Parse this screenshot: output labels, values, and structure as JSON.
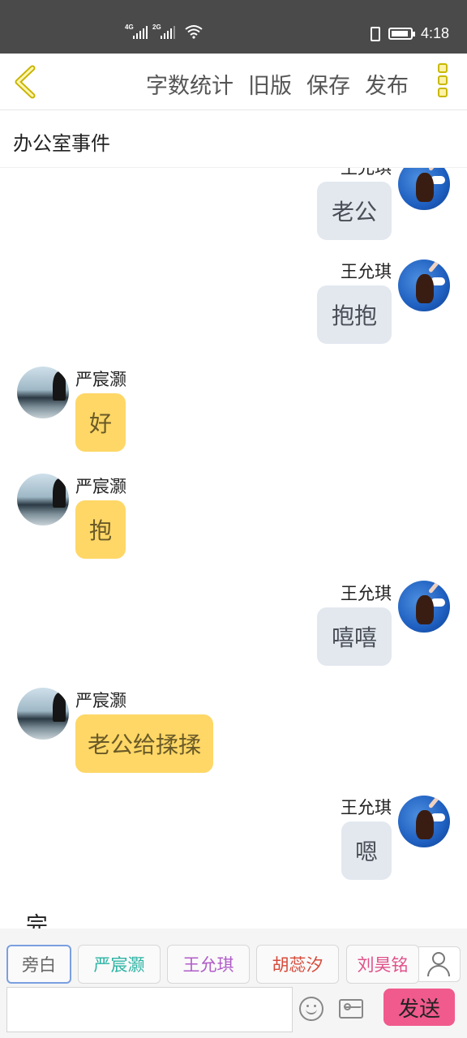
{
  "status_bar": {
    "net1": "4G",
    "net2": "2G",
    "time": "4:18",
    "battery_percent": 90
  },
  "header": {
    "actions": [
      "字数统计",
      "旧版",
      "保存",
      "发布"
    ]
  },
  "document": {
    "title": "办公室事件"
  },
  "messages": [
    {
      "sender": "王允琪",
      "text": "老公",
      "side": "right"
    },
    {
      "sender": "王允琪",
      "text": "抱抱",
      "side": "right"
    },
    {
      "sender": "严宸灏",
      "text": "好",
      "side": "left"
    },
    {
      "sender": "严宸灏",
      "text": "抱",
      "side": "left"
    },
    {
      "sender": "王允琪",
      "text": "嘻嘻",
      "side": "right"
    },
    {
      "sender": "严宸灏",
      "text": "老公给揉揉",
      "side": "left"
    },
    {
      "sender": "王允琪",
      "text": "嗯",
      "side": "right"
    }
  ],
  "narration": "完",
  "roles": [
    {
      "label": "旁白",
      "color": "#666666",
      "active": true
    },
    {
      "label": "严宸灏",
      "color": "#2bb3a3",
      "active": false
    },
    {
      "label": "王允琪",
      "color": "#b05cc8",
      "active": false
    },
    {
      "label": "胡蕊汐",
      "color": "#d64a3a",
      "active": false
    },
    {
      "label": "刘昊铭",
      "color": "#e0508a",
      "active": false
    }
  ],
  "input": {
    "value": "",
    "send_label": "发送"
  }
}
